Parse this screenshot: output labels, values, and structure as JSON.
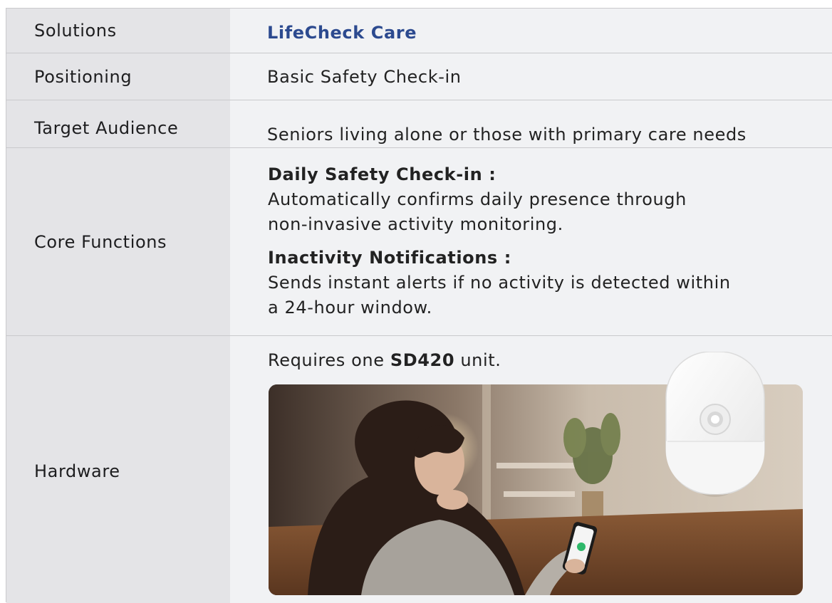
{
  "rows": {
    "solutions": {
      "label": "Solutions",
      "value": "LifeCheck Care"
    },
    "positioning": {
      "label": "Positioning",
      "value": "Basic Safety Check-in"
    },
    "audience": {
      "label": "Target Audience",
      "value": "Seniors living alone or those with primary care needs"
    },
    "functions": {
      "label": "Core Functions",
      "items": [
        {
          "title": "Daily Safety Check-in :",
          "line1": "Automatically confirms daily presence through",
          "line2": "non-invasive activity monitoring."
        },
        {
          "title": "Inactivity Notifications :",
          "line1": "Sends instant alerts if no activity is detected within",
          "line2": "a 24-hour window."
        }
      ]
    },
    "hardware": {
      "label": "Hardware",
      "prefix": "Requires one ",
      "unit": "SD420",
      "suffix": " unit."
    }
  }
}
